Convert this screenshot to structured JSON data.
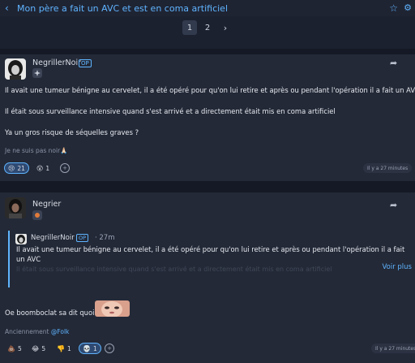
{
  "topbar": {
    "back_icon": "‹",
    "title": "Mon père a fait un AVC et est en coma artificiel",
    "star_icon": "☆",
    "settings_icon": "⚙"
  },
  "pagination": {
    "pages": [
      "1",
      "2"
    ],
    "current": "1",
    "next_icon": "›"
  },
  "posts": [
    {
      "author": "NegrillerNoir",
      "op_badge": "OP",
      "paragraphs": [
        "Il avait une tumeur bénigne au cervelet, il a été opéré pour qu'on lui retire et après ou pendant l'opération il a fait un AVC",
        "Il était sous surveillance intensive quand s'est arrivé et a directement était mis en coma artificiel",
        "Ya un gros risque de séquelles graves ?"
      ],
      "signature": "Je ne suis pas noir🙏🏻",
      "reactions": [
        {
          "emoji": "😢",
          "count": "21",
          "active": true
        },
        {
          "emoji": "😲",
          "count": "1",
          "active": false
        }
      ],
      "time": "Il y a 27 minutes"
    },
    {
      "author": "Negrier",
      "quote": {
        "author": "NegrillerNoir",
        "op_badge": "OP",
        "time": "· 27m",
        "text": "Il avait une tumeur bénigne au cervelet, il a été opéré pour qu'on lui retire et après ou pendant l'opération il a fait un AVC",
        "faded": "Il était sous surveillance intensive quand s'est arrivé et a directement était mis en coma artificiel",
        "more_label": "Voir plus"
      },
      "body": "Oe boomboclat sa dit quoi",
      "signature_prefix": "Anciennement ",
      "signature_mention": "@Folk",
      "reactions": [
        {
          "emoji": "💩",
          "count": "5",
          "active": false
        },
        {
          "emoji": "😂",
          "count": "5",
          "active": false
        },
        {
          "emoji": "👎",
          "count": "1",
          "active": false
        },
        {
          "emoji": "💀",
          "count": "1",
          "active": true
        }
      ],
      "time": "Il y a 27 minutes"
    }
  ],
  "icons": {
    "share": "share-arrow-icon",
    "add_reaction": "add-reaction-icon"
  },
  "colors": {
    "accent": "#5fb4ff",
    "background": "#1c2130",
    "post_bg": "#232937"
  }
}
